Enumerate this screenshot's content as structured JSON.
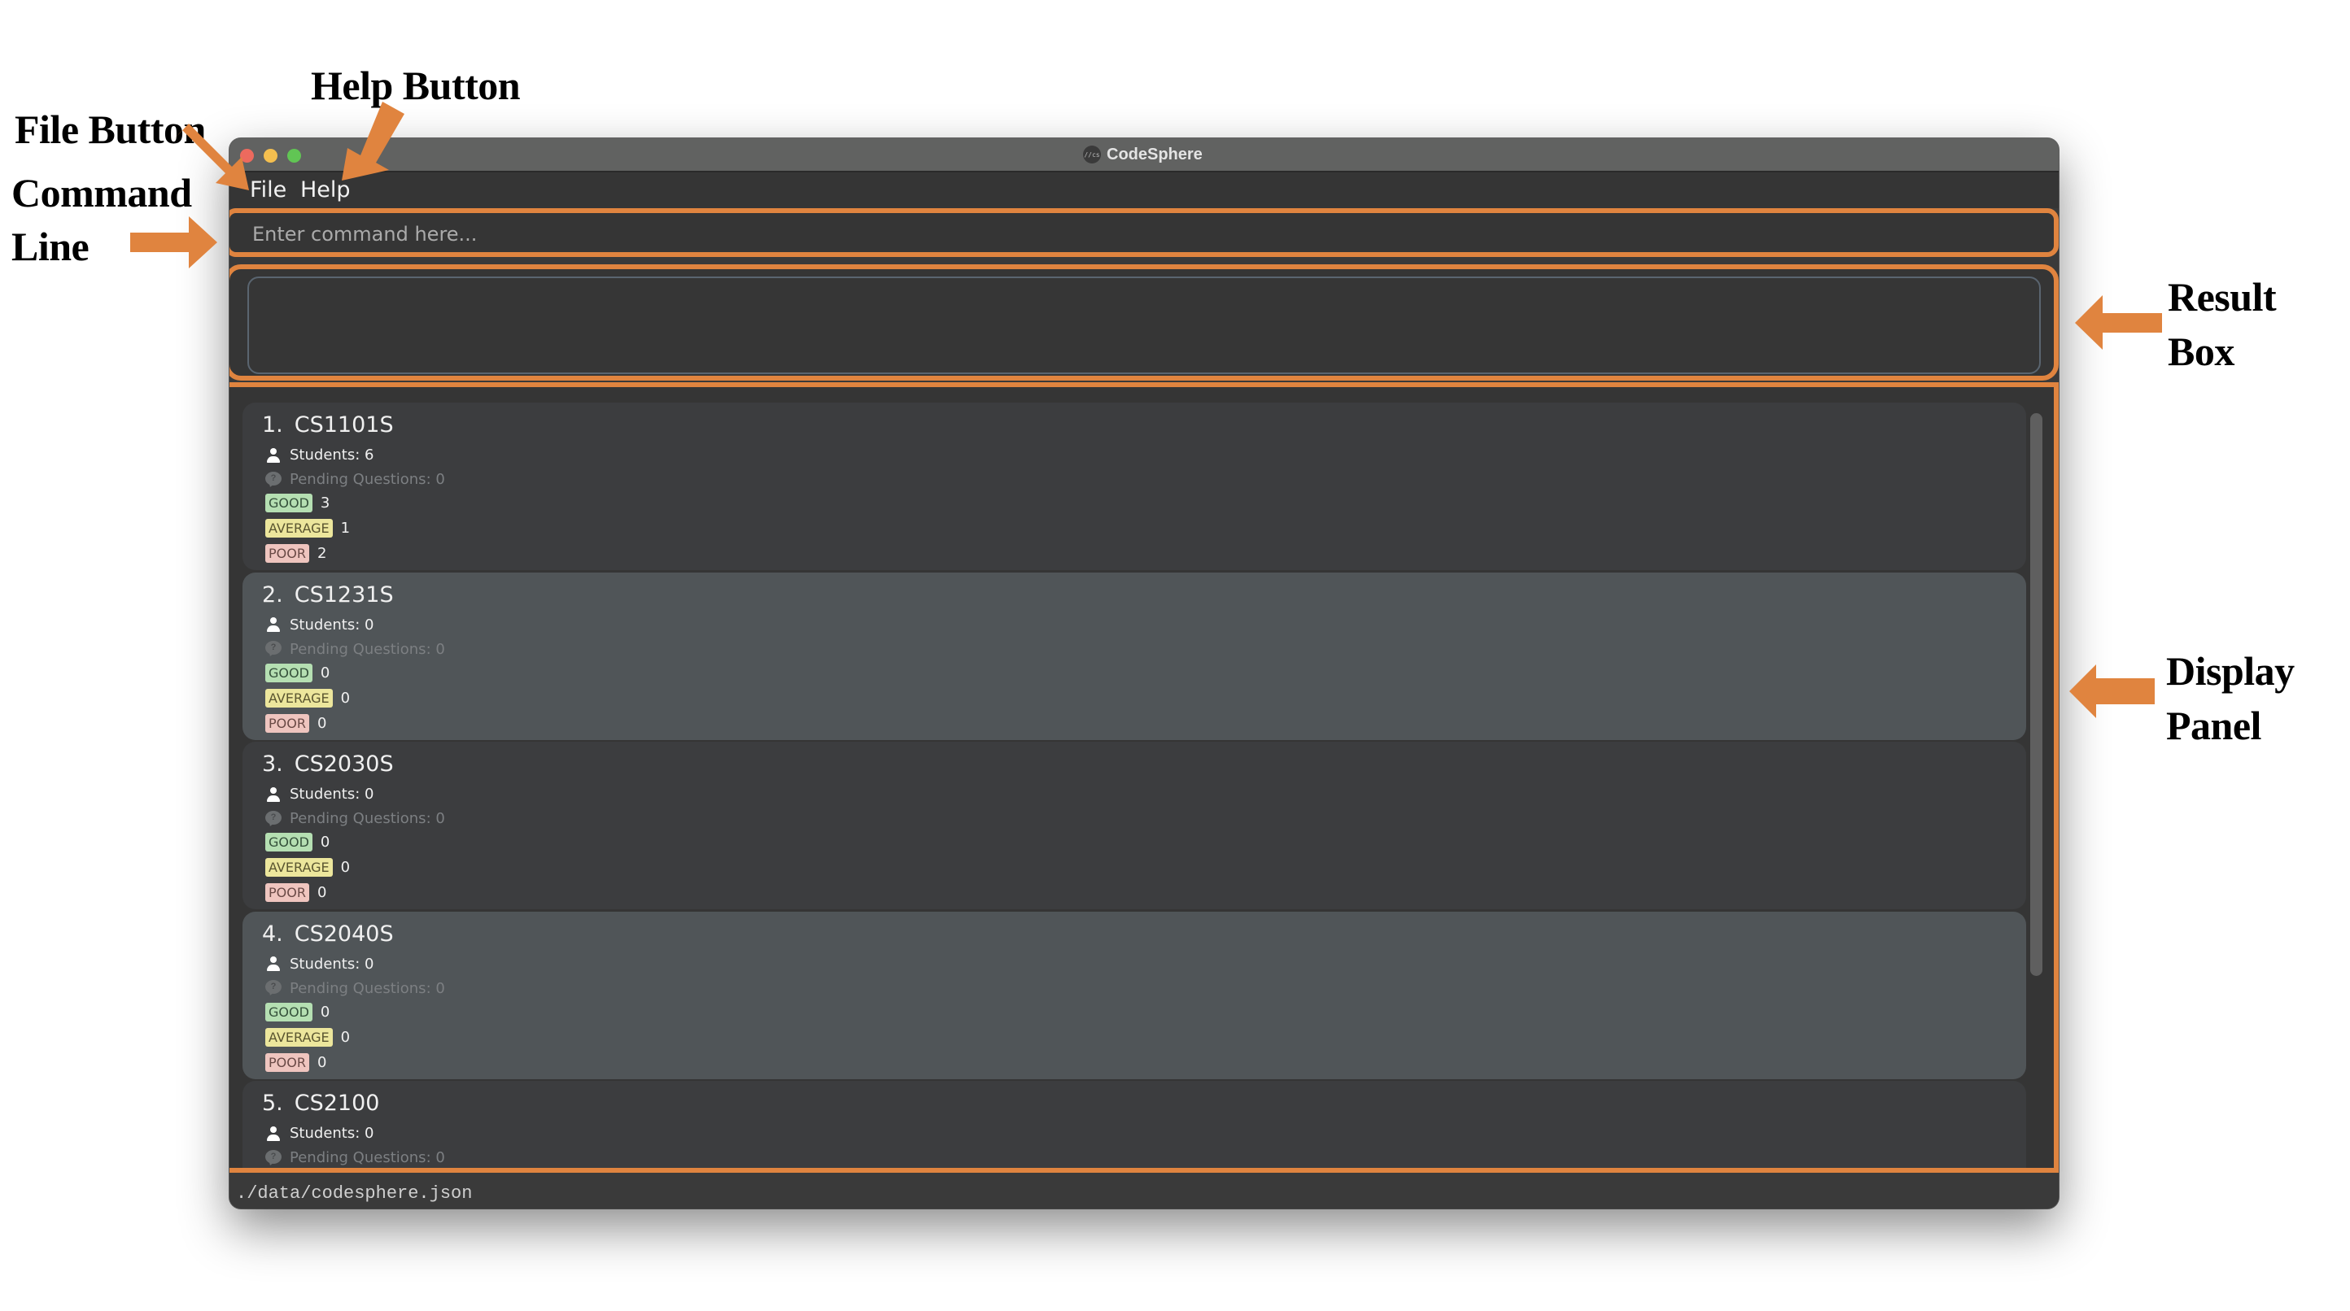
{
  "annotations": {
    "file_button": "File Button",
    "help_button": "Help Button",
    "command_line_1": "Command",
    "command_line_2": "Line",
    "result_box_1": "Result",
    "result_box_2": "Box",
    "display_panel_1": "Display",
    "display_panel_2": "Panel",
    "accent_color": "#e0843f"
  },
  "window": {
    "title": "CodeSphere",
    "app_icon_text": "//cs"
  },
  "menu": {
    "file": "File",
    "help": "Help"
  },
  "command": {
    "placeholder": "Enter command here...",
    "value": ""
  },
  "result": {
    "text": ""
  },
  "courses": [
    {
      "index": "1.",
      "code": "CS1101S",
      "students": "Students: 6",
      "pending": "Pending Questions: 0",
      "good": "3",
      "average": "1",
      "poor": "2"
    },
    {
      "index": "2.",
      "code": "CS1231S",
      "students": "Students: 0",
      "pending": "Pending Questions: 0",
      "good": "0",
      "average": "0",
      "poor": "0"
    },
    {
      "index": "3.",
      "code": "CS2030S",
      "students": "Students: 0",
      "pending": "Pending Questions: 0",
      "good": "0",
      "average": "0",
      "poor": "0"
    },
    {
      "index": "4.",
      "code": "CS2040S",
      "students": "Students: 0",
      "pending": "Pending Questions: 0",
      "good": "0",
      "average": "0",
      "poor": "0"
    },
    {
      "index": "5.",
      "code": "CS2100",
      "students": "Students: 0",
      "pending": "Pending Questions: 0",
      "good": "",
      "average": "",
      "poor": ""
    }
  ],
  "badges": {
    "good": "GOOD",
    "average": "AVERAGE",
    "poor": "POOR"
  },
  "status": {
    "file_path": "./data/codesphere.json"
  }
}
